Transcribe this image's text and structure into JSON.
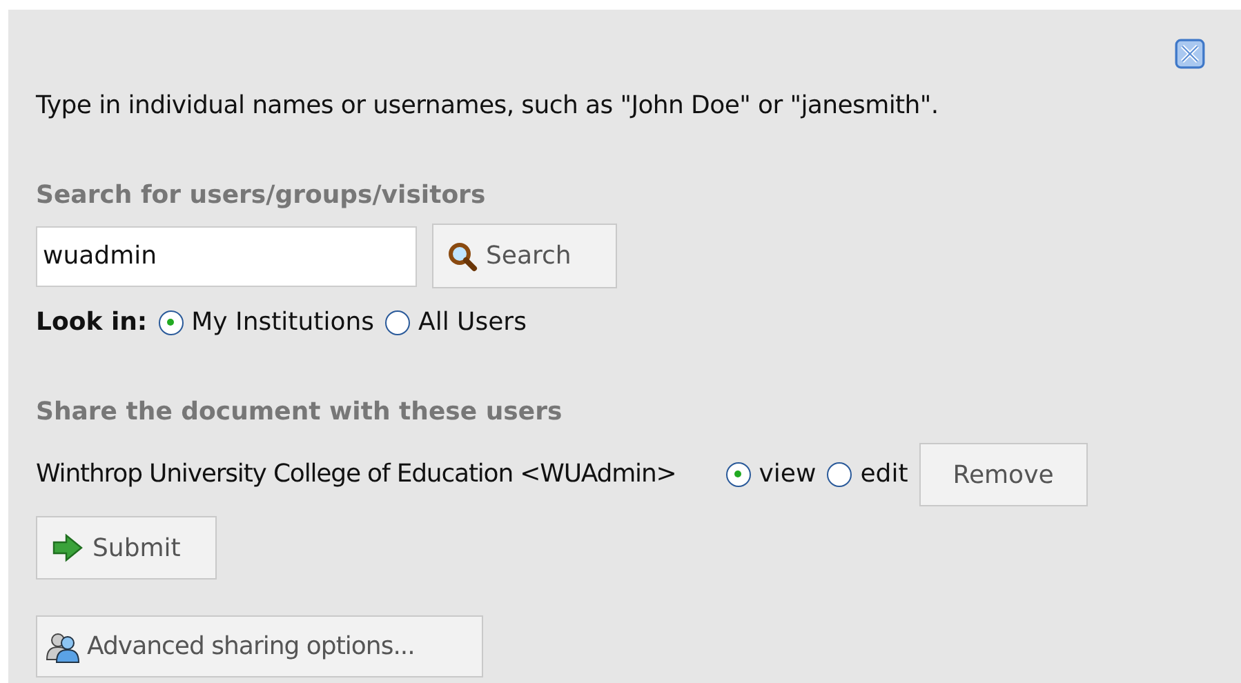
{
  "dialog": {
    "instructions": "Type in individual names or usernames, such as \"John Doe\" or \"janesmith\".",
    "search": {
      "heading": "Search for users/groups/visitors",
      "value": "wuadmin",
      "button": "Search"
    },
    "look_in": {
      "label": "Look in:",
      "options": [
        {
          "label": "My Institutions",
          "selected": true
        },
        {
          "label": "All Users",
          "selected": false
        }
      ]
    },
    "share": {
      "heading": "Share the document with these users",
      "users": [
        {
          "name": "Winthrop University College of Education <WUAdmin>",
          "permissions": [
            {
              "label": "view",
              "selected": true
            },
            {
              "label": "edit",
              "selected": false
            }
          ],
          "remove": "Remove"
        }
      ]
    },
    "submit": "Submit",
    "advanced": "Advanced sharing options..."
  }
}
